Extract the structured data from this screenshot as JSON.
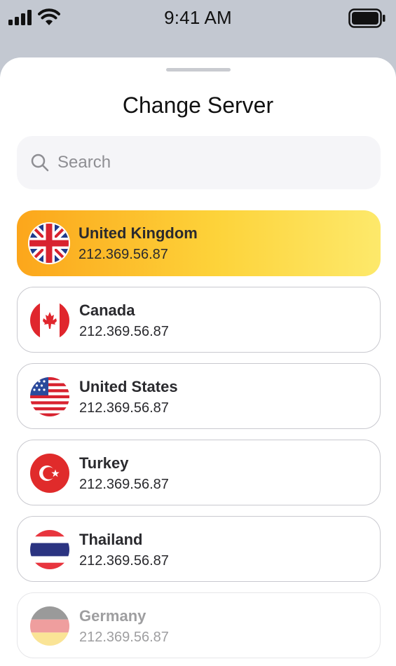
{
  "status_bar": {
    "time": "9:41 AM"
  },
  "sheet": {
    "title": "Change Server"
  },
  "search": {
    "placeholder": "Search",
    "value": ""
  },
  "servers": [
    {
      "name": "United Kingdom",
      "ip": "212.369.56.87",
      "flag_icon": "uk-flag-icon",
      "selected": true
    },
    {
      "name": "Canada",
      "ip": "212.369.56.87",
      "flag_icon": "canada-flag-icon",
      "selected": false
    },
    {
      "name": "United States",
      "ip": "212.369.56.87",
      "flag_icon": "us-flag-icon",
      "selected": false
    },
    {
      "name": "Turkey",
      "ip": "212.369.56.87",
      "flag_icon": "turkey-flag-icon",
      "selected": false
    },
    {
      "name": "Thailand",
      "ip": "212.369.56.87",
      "flag_icon": "thailand-flag-icon",
      "selected": false
    },
    {
      "name": "Germany",
      "ip": "212.369.56.87",
      "flag_icon": "germany-flag-icon",
      "selected": false
    }
  ],
  "colors": {
    "selected_gradient_start": "#fca61b",
    "selected_gradient_end": "#fde96b",
    "status_bar_bg": "#c3c8d1",
    "search_bg": "#f5f5f8"
  }
}
